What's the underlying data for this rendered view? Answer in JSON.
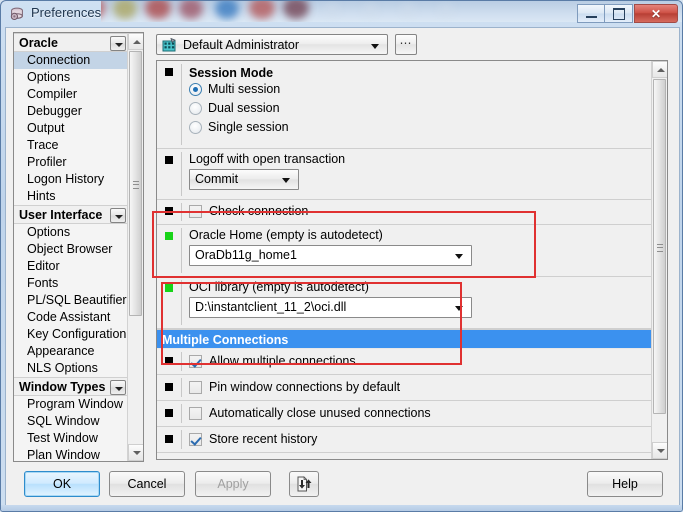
{
  "window": {
    "title": "Preferences",
    "icon": "database-preferences-icon",
    "buttons": {
      "minimize": "minimize-icon",
      "maximize": "maximize-icon",
      "close": "✕"
    }
  },
  "toolbar": {
    "profile_icon": "user-profile-icon",
    "profile_value": "Default Administrator",
    "ellipsis_label": "⋯"
  },
  "sidebar": {
    "groups": [
      {
        "label": "Oracle",
        "items": [
          {
            "label": "Connection",
            "selected": true
          },
          {
            "label": "Options",
            "selected": false
          },
          {
            "label": "Compiler",
            "selected": false
          },
          {
            "label": "Debugger",
            "selected": false
          },
          {
            "label": "Output",
            "selected": false
          },
          {
            "label": "Trace",
            "selected": false
          },
          {
            "label": "Profiler",
            "selected": false
          },
          {
            "label": "Logon History",
            "selected": false
          },
          {
            "label": "Hints",
            "selected": false
          }
        ]
      },
      {
        "label": "User Interface",
        "items": [
          {
            "label": "Options",
            "selected": false
          },
          {
            "label": "Object Browser",
            "selected": false
          },
          {
            "label": "Editor",
            "selected": false
          },
          {
            "label": "Fonts",
            "selected": false
          },
          {
            "label": "PL/SQL Beautifier",
            "selected": false
          },
          {
            "label": "Code Assistant",
            "selected": false
          },
          {
            "label": "Key Configuration",
            "selected": false
          },
          {
            "label": "Appearance",
            "selected": false
          },
          {
            "label": "NLS Options",
            "selected": false
          }
        ]
      },
      {
        "label": "Window Types",
        "items": [
          {
            "label": "Program Window",
            "selected": false
          },
          {
            "label": "SQL Window",
            "selected": false
          },
          {
            "label": "Test Window",
            "selected": false
          },
          {
            "label": "Plan Window",
            "selected": false
          }
        ]
      }
    ]
  },
  "settings": {
    "session_mode": {
      "title": "Session Mode",
      "options": [
        {
          "label": "Multi session",
          "checked": true
        },
        {
          "label": "Dual session",
          "checked": false
        },
        {
          "label": "Single session",
          "checked": false
        }
      ]
    },
    "logoff": {
      "title": "Logoff with open transaction",
      "value": "Commit"
    },
    "check_connection": {
      "label": "Check connection",
      "checked": false
    },
    "oracle_home": {
      "title": "Oracle Home (empty is autodetect)",
      "value": "OraDb11g_home1"
    },
    "oci_library": {
      "title": "OCI library (empty is autodetect)",
      "value": "D:\\instantclient_11_2\\oci.dll"
    },
    "multiple_connections": {
      "section_title": "Multiple Connections",
      "items": [
        {
          "label": "Allow multiple connections",
          "checked": true
        },
        {
          "label": "Pin window connections by default",
          "checked": false
        },
        {
          "label": "Automatically close unused connections",
          "checked": false
        },
        {
          "label": "Store recent history",
          "checked": true
        }
      ]
    }
  },
  "footer": {
    "ok": "OK",
    "cancel": "Cancel",
    "apply": "Apply",
    "import_export_icon": "import-export-icon",
    "help": "Help"
  },
  "colors": {
    "accent_blue": "#3b91ef",
    "annotation_red": "#e03131",
    "modified_marker_green": "#18d318",
    "selection_grey": "#c3d4e6"
  }
}
